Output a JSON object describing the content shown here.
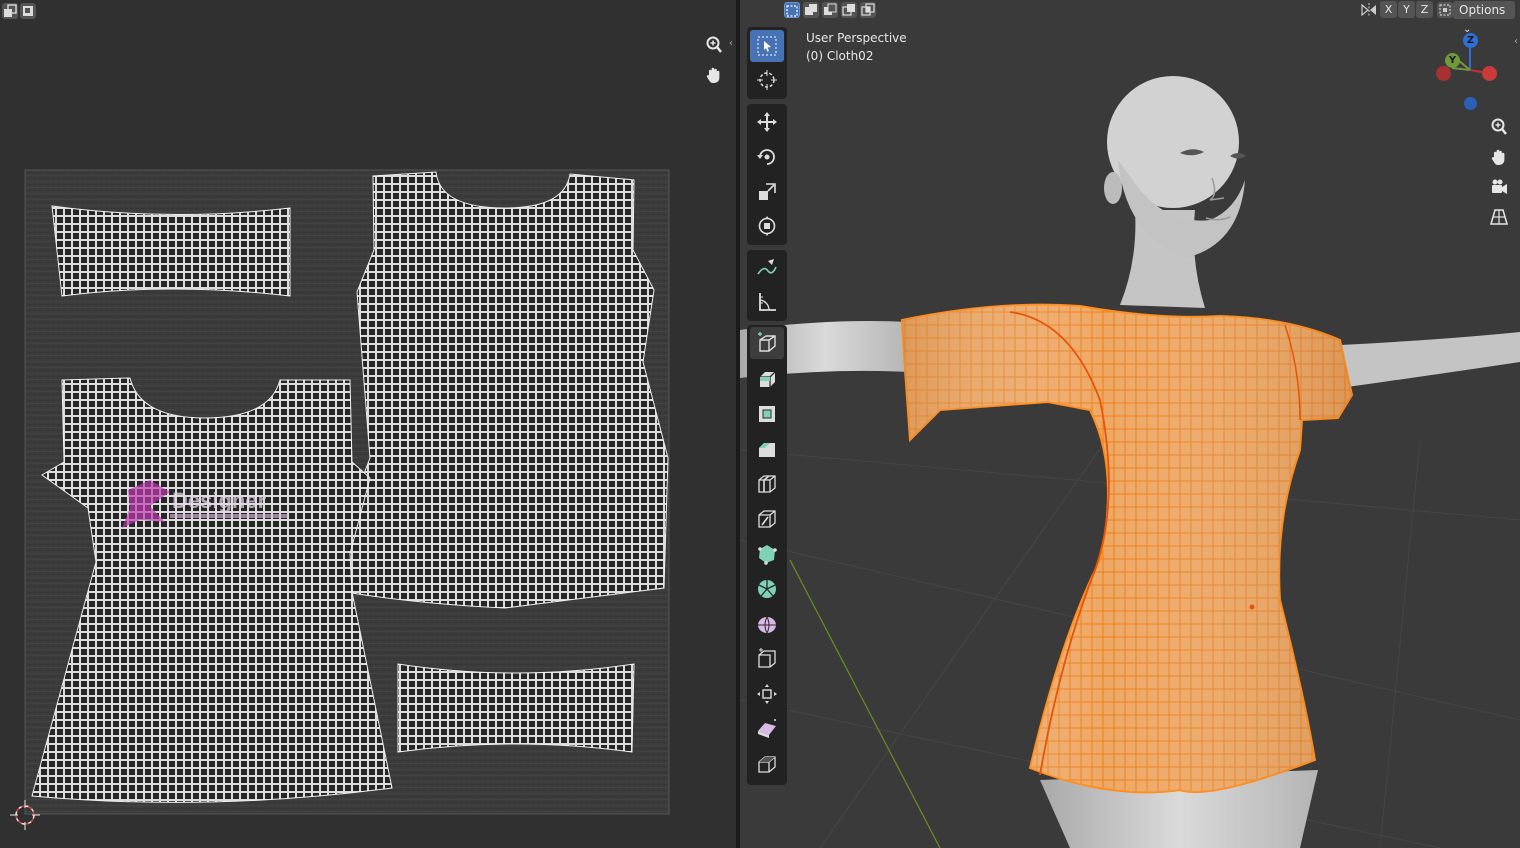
{
  "uv_editor": {
    "header_icons": [
      "sync-selection-icon",
      "uv-select-mode-icon"
    ],
    "nav_icons": [
      "zoom-icon",
      "hand-pan-icon"
    ],
    "texture_label": "Designer"
  },
  "viewport": {
    "header": {
      "select_mode_icons": [
        "select-new-icon",
        "select-extend-icon",
        "select-subtract-icon",
        "select-invert-icon",
        "select-intersect-icon"
      ],
      "mirror_axes": [
        "X",
        "Y",
        "Z"
      ],
      "options_label": "Options",
      "options_arrow": "⌄"
    },
    "overlay": {
      "view_name": "User Perspective",
      "object_name": "(0) Cloth02"
    },
    "gizmo": {
      "z_label": "Z",
      "y_label": "Y"
    },
    "tools": [
      "select-box-icon",
      "cursor-icon",
      "move-icon",
      "rotate-icon",
      "scale-icon",
      "transform-icon",
      "annotate-icon",
      "measure-icon",
      "add-cube-icon",
      "extrude-icon",
      "inset-icon",
      "bevel-icon",
      "loop-cut-icon",
      "knife-icon",
      "poly-build-icon",
      "spin-icon",
      "smooth-icon",
      "edge-slide-icon",
      "shrink-fatten-icon",
      "shear-icon",
      "rip-region-icon"
    ],
    "nav_icons": [
      "zoom-icon",
      "hand-pan-icon",
      "camera-view-icon",
      "perspective-grid-icon"
    ],
    "colors": {
      "selection": "#ff8c1a",
      "active_tool": "#4772b3",
      "mesh_fill": "#e8a15a",
      "body": "#cfcfcf"
    }
  }
}
